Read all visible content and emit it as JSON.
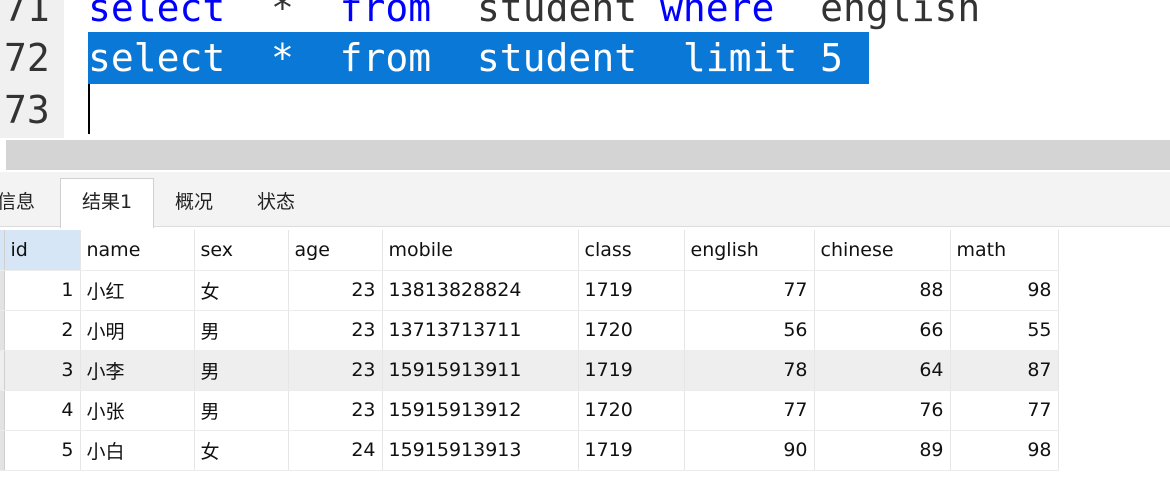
{
  "editor": {
    "lines": [
      {
        "number": "71",
        "tokens": [
          {
            "text": "select",
            "kw": true
          },
          {
            "text": "  *  ",
            "kw": false
          },
          {
            "text": "from",
            "kw": true
          },
          {
            "text": "  student ",
            "kw": false
          },
          {
            "text": "where",
            "kw": true
          },
          {
            "text": "  english",
            "kw": false
          }
        ]
      },
      {
        "number": "72",
        "selected": true,
        "tokens": [
          {
            "text": "select  *  from  student  limit 5",
            "kw": false
          }
        ]
      },
      {
        "number": "73",
        "tokens": []
      }
    ]
  },
  "tabs": {
    "info": "信息",
    "result1": "结果1",
    "overview": "概况",
    "status": "状态"
  },
  "grid": {
    "columns": [
      "id",
      "name",
      "sex",
      "age",
      "mobile",
      "class",
      "english",
      "chinese",
      "math"
    ],
    "rows": [
      [
        "1",
        "小红",
        "女",
        "23",
        "13813828824",
        "1719",
        "77",
        "88",
        "98"
      ],
      [
        "2",
        "小明",
        "男",
        "23",
        "13713713711",
        "1720",
        "56",
        "66",
        "55"
      ],
      [
        "3",
        "小李",
        "男",
        "23",
        "15915913911",
        "1719",
        "78",
        "64",
        "87"
      ],
      [
        "4",
        "小张",
        "男",
        "23",
        "15915913912",
        "1720",
        "77",
        "76",
        "77"
      ],
      [
        "5",
        "小白",
        "女",
        "24",
        "15915913913",
        "1719",
        "90",
        "89",
        "98"
      ]
    ]
  },
  "colors": {
    "keyword": "#0000ff",
    "selection": "#0a78d7",
    "id_header": "#d6e6f7"
  }
}
